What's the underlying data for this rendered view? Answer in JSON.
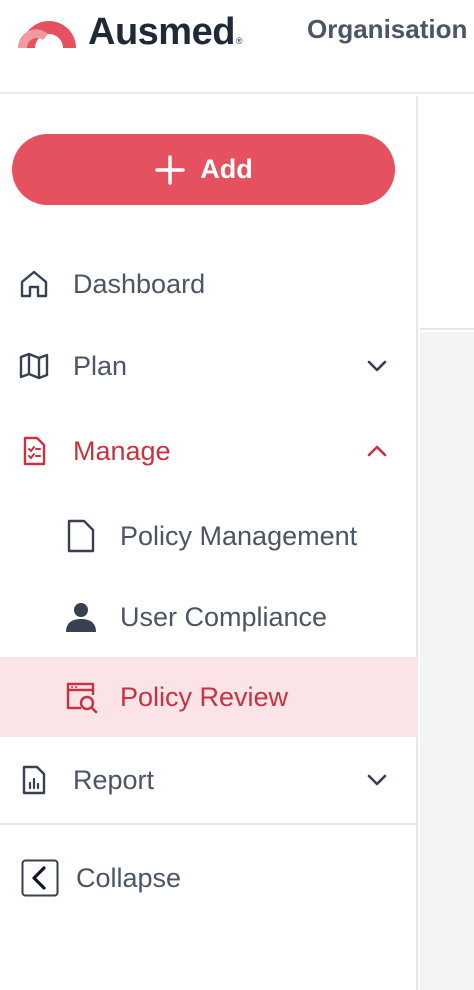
{
  "header": {
    "brand": "Ausmed",
    "brand_mark": "®",
    "org_label": "Organisation"
  },
  "sidebar": {
    "add_label": "Add",
    "items": [
      {
        "label": "Dashboard",
        "icon": "home-icon"
      },
      {
        "label": "Plan",
        "icon": "map-icon",
        "expanded": false
      },
      {
        "label": "Manage",
        "icon": "clipboard-check-icon",
        "expanded": true,
        "active": true
      },
      {
        "label": "Report",
        "icon": "report-icon",
        "expanded": false
      }
    ],
    "manage_children": [
      {
        "label": "Policy Management",
        "icon": "document-icon"
      },
      {
        "label": "User Compliance",
        "icon": "user-icon"
      },
      {
        "label": "Policy Review",
        "icon": "browser-search-icon",
        "selected": true
      }
    ],
    "collapse_label": "Collapse"
  },
  "colors": {
    "accent": "#e5515f",
    "active_text": "#c9323f",
    "selected_bg": "#fbe4e7",
    "text": "#4b5563"
  }
}
